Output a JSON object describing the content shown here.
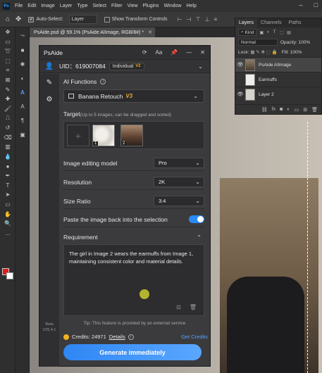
{
  "menubar": {
    "logo": "Ps",
    "items": [
      "File",
      "Edit",
      "Image",
      "Layer",
      "Type",
      "Select",
      "Filter",
      "View",
      "Plugins",
      "Window",
      "Help"
    ]
  },
  "optionsbar": {
    "auto_select_label": "Auto-Select:",
    "auto_select_value": "Layer",
    "show_transform_label": "Show Transform Controls"
  },
  "document": {
    "tab_title": "PsAide.psd @ 59.1% (PsAide AIImage, RGB/8#) *"
  },
  "layers_panel": {
    "tabs": [
      "Layers",
      "Channels",
      "Paths"
    ],
    "filter_label": "Kind",
    "blend_mode": "Normal",
    "opacity_label": "Opacity:",
    "opacity_value": "100%",
    "lock_label": "Lock:",
    "fill_label": "Fill:",
    "fill_value": "100%",
    "layers": [
      {
        "name": "PsAide AIImage",
        "visible": true,
        "selected": true
      },
      {
        "name": "Earmuffs",
        "visible": false,
        "selected": false
      },
      {
        "name": "Layer 2",
        "visible": true,
        "selected": false
      }
    ]
  },
  "psaide": {
    "title": "PsAide",
    "header_icons": [
      "refresh-icon",
      "text-size-icon",
      "pin-icon",
      "minimize-icon",
      "close-icon"
    ],
    "uid": "UID：619007084",
    "plan": "Individual",
    "plan_badge": "V2",
    "ai_functions_label": "AI Functions",
    "function_name": "Banana Retouch",
    "function_version": "V3",
    "target_label": "Target",
    "target_hint": "(Up to 5 images, can be dragged and sorted)",
    "target_thumbs": [
      "1",
      "2"
    ],
    "image_model_label": "Image editing model",
    "image_model_value": "Pro",
    "resolution_label": "Resolution",
    "resolution_value": "2K",
    "size_ratio_label": "Size Ratio",
    "size_ratio_value": "3:4",
    "paste_back_label": "Paste the image back into the selection",
    "paste_back_on": true,
    "requirement_label": "Requirement",
    "requirement_text": "The girl in Image 2 wears the earmuffs from Image 1, maintaining consistent color and material details.",
    "tip": "Tip: This feature is provided by an external service",
    "credits_label": "Credits: 24971",
    "details_label": "Details",
    "get_credits_label": "Get Credits",
    "generate_label": "Generate immediately",
    "version_line1": "Beta",
    "version_line2": "V25.4.1"
  },
  "colors": {
    "accent": "#2f86f3",
    "foreground_color": "#e01b1b",
    "background_color": "#ffffff",
    "v_badge": "#f0a42a"
  }
}
